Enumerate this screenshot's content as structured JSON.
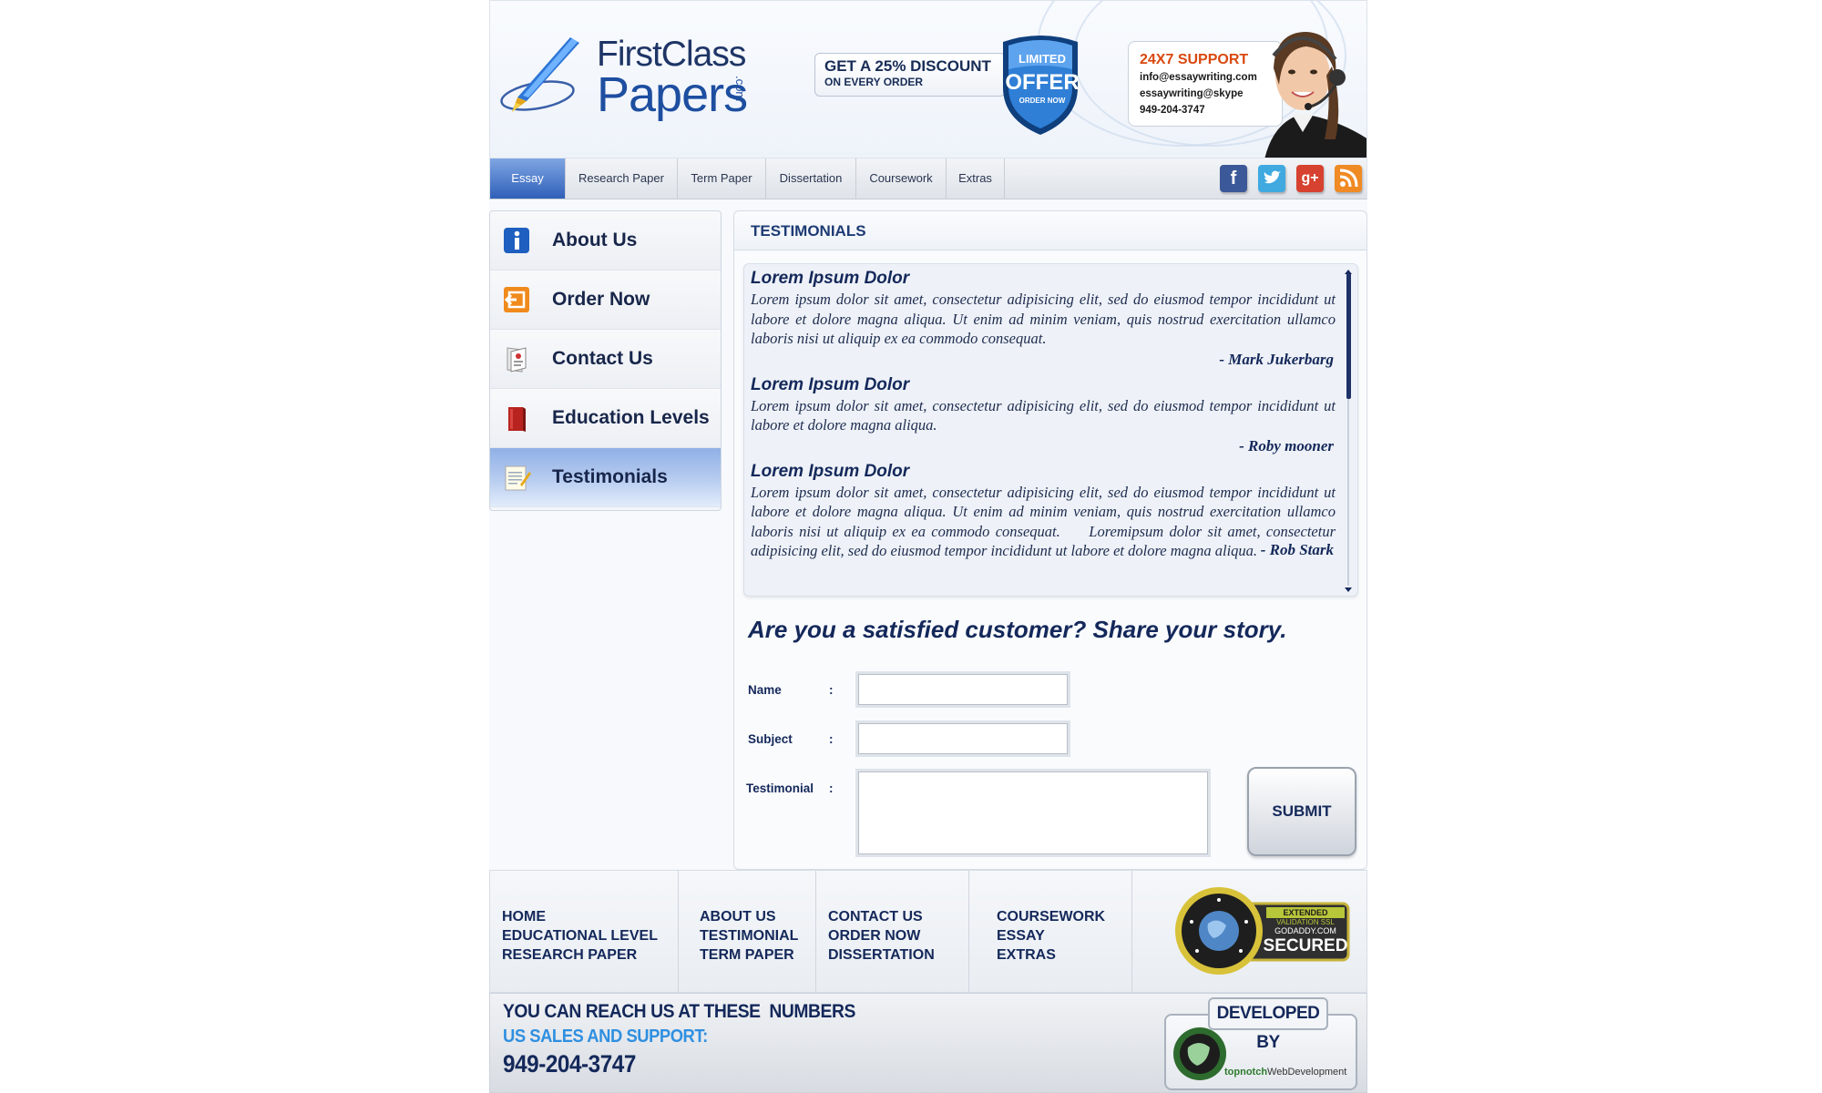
{
  "brand": {
    "line1": "FirstClass",
    "line2": "Papers",
    "suffix": ".com"
  },
  "promo": {
    "discount_line1": "GET A 25% DISCOUNT",
    "discount_line2": "ON EVERY ORDER",
    "badge_top": "LIMITED",
    "badge_main": "OFFER",
    "badge_bottom": "ORDER NOW"
  },
  "support": {
    "title": "24X7 SUPPORT",
    "email": "info@essaywriting.com",
    "skype": "essaywriting@skype",
    "phone": "949-204-3747"
  },
  "nav": {
    "items": [
      "Essay",
      "Research Paper",
      "Term Paper",
      "Dissertation",
      "Coursework",
      "Extras"
    ],
    "active": "Essay"
  },
  "social": {
    "icons": [
      "facebook-icon",
      "twitter-icon",
      "google-plus-icon",
      "rss-icon"
    ],
    "colors": [
      "#3b5998",
      "#3fa9e0",
      "#d6422f",
      "#f08a24"
    ]
  },
  "sidebar": {
    "items": [
      {
        "label": "About Us",
        "icon": "info-icon"
      },
      {
        "label": "Order Now",
        "icon": "order-icon"
      },
      {
        "label": "Contact Us",
        "icon": "contact-icon"
      },
      {
        "label": "Education Levels",
        "icon": "book-icon"
      },
      {
        "label": "Testimonials",
        "icon": "notepad-icon"
      }
    ],
    "active": "Testimonials"
  },
  "main": {
    "title": "TESTIMONIALS",
    "testimonials": [
      {
        "title": "Lorem Ipsum Dolor",
        "body": "Lorem ipsum dolor sit amet, consectetur adipisicing elit, sed do eiusmod tempor incididunt ut labore et dolore magna aliqua. Ut enim ad minim veniam, quis nostrud exercitation ullamco laboris nisi ut aliquip ex ea commodo consequat.",
        "author": "- Mark Jukerbarg"
      },
      {
        "title": "Lorem Ipsum Dolor",
        "body": "Lorem ipsum dolor sit amet, consectetur adipisicing elit, sed do eiusmod tempor incididunt ut labore et dolore magna aliqua.",
        "author": "- Roby mooner"
      },
      {
        "title": "Lorem Ipsum Dolor",
        "body": "Lorem ipsum dolor sit amet, consectetur adipisicing elit, sed do eiusmod tempor incididunt ut labore et dolore magna aliqua. Ut enim ad minim veniam, quis nostrud exercitation ullamco laboris nisi ut aliquip ex ea commodo consequat.     Loremipsum dolor sit amet, consectetur adipisicing elit, sed do eiusmod tempor incididunt ut labore et dolore magna aliqua.",
        "author": "- Rob Stark"
      }
    ],
    "share_heading": "Are you a satisfied customer? Share your story.",
    "form": {
      "name_label": "Name",
      "subject_label": "Subject",
      "testimonial_label": "Testimonial",
      "colon": ":",
      "name_value": "",
      "subject_value": "",
      "testimonial_value": "",
      "submit_label": "SUBMIT"
    }
  },
  "footer": {
    "columns": [
      [
        "HOME",
        "EDUCATIONAL LEVEL",
        "RESEARCH PAPER"
      ],
      [
        "ABOUT US",
        "TESTIMONIAL",
        "TERM PAPER"
      ],
      [
        "CONTACT US",
        "ORDER NOW",
        "DISSERTATION"
      ],
      [
        "COURSEWORK",
        "ESSAY",
        "EXTRAS"
      ]
    ],
    "ssl": {
      "line1": "EXTENDED",
      "line2": "VALIDATION SSL",
      "line3": "GODADDY.COM",
      "line4": "SECURED"
    },
    "reach_title": "YOU CAN REACH US AT THESE  NUMBERS",
    "sales_title": "US SALES AND SUPPORT:",
    "sales_phone": "949-204-3747",
    "developed_by": "DEVELOPED BY",
    "developer_bold": "topnotch",
    "developer_rest": "WebDevelopment"
  },
  "colors": {
    "navy": "#14285a",
    "accent_blue": "#2f5fb8",
    "support_orange": "#d9480f",
    "sales_blue": "#2f8fe0"
  }
}
